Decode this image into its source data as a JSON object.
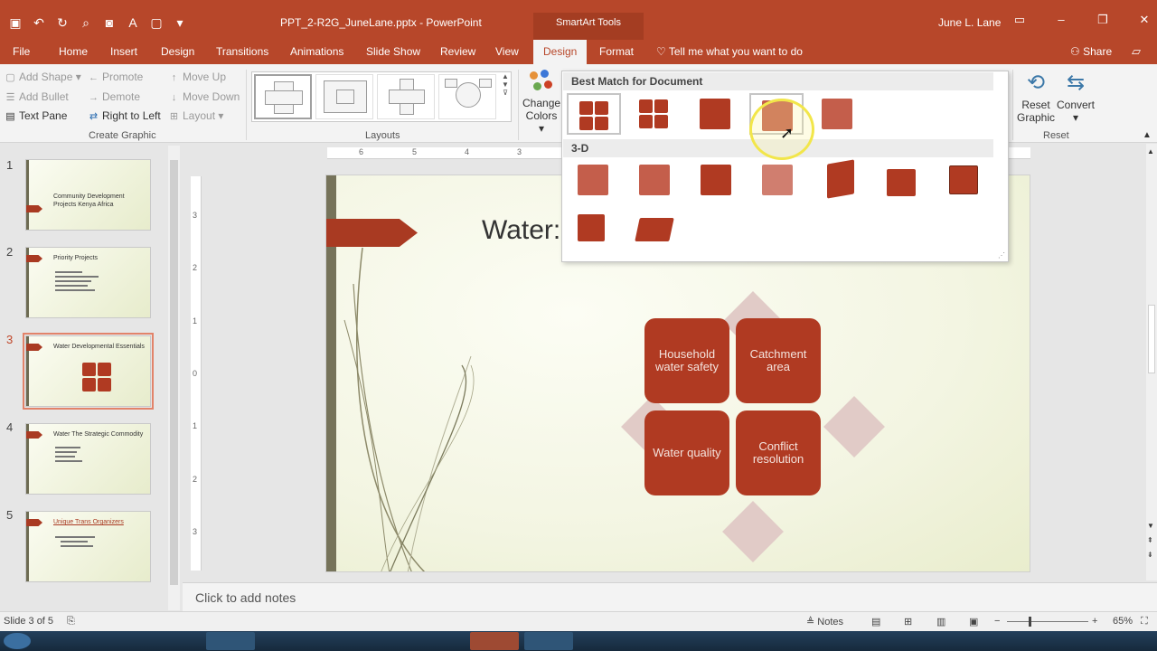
{
  "titlebar": {
    "document_title": "PPT_2-R2G_JuneLane.pptx  -  PowerPoint",
    "context_tools": "SmartArt Tools",
    "user": "June L. Lane",
    "qat_icons": [
      "save-icon",
      "undo-icon",
      "redo-icon",
      "preview-icon",
      "screenshot-icon",
      "font-color-icon",
      "new-icon",
      "customize-icon"
    ]
  },
  "tabs": [
    {
      "label": "File"
    },
    {
      "label": "Home"
    },
    {
      "label": "Insert"
    },
    {
      "label": "Design"
    },
    {
      "label": "Transitions"
    },
    {
      "label": "Animations"
    },
    {
      "label": "Slide Show"
    },
    {
      "label": "Review"
    },
    {
      "label": "View"
    },
    {
      "label": "Design",
      "active": true
    },
    {
      "label": "Format"
    }
  ],
  "tell_me": "Tell me what you want to do",
  "share": "Share",
  "ribbon": {
    "create_graphic": {
      "label": "Create Graphic",
      "add_shape": "Add Shape",
      "add_bullet": "Add Bullet",
      "text_pane": "Text Pane",
      "promote": "Promote",
      "demote": "Demote",
      "right_to_left": "Right to Left",
      "move_up": "Move Up",
      "move_down": "Move Down",
      "layout": "Layout"
    },
    "layouts": {
      "label": "Layouts"
    },
    "change_colors": [
      "Change",
      "Colors"
    ],
    "reset": {
      "label": "Reset",
      "reset_graphic": [
        "Reset",
        "Graphic"
      ],
      "convert": "Convert"
    }
  },
  "styles_panel": {
    "best_match_header": "Best Match for Document",
    "three_d_header": "3-D"
  },
  "slides": [
    {
      "num": "1",
      "title": "Community Development Projects Kenya Africa"
    },
    {
      "num": "2",
      "title": "Priority Projects"
    },
    {
      "num": "3",
      "title": "Water Developmental Essentials"
    },
    {
      "num": "4",
      "title": "Water The Strategic Commodity"
    },
    {
      "num": "5",
      "title": "Unique Trans Organizers"
    }
  ],
  "ruler": {
    "horizontal": [
      "6",
      "5",
      "4",
      "3"
    ],
    "vertical": [
      "3",
      "2",
      "1",
      "0",
      "1",
      "2",
      "3"
    ]
  },
  "slide": {
    "title_partial": "Water:",
    "boxes": [
      "Household water safety",
      "Catchment area",
      "Water quality",
      "Conflict resolution"
    ],
    "accent_color": "#b03a22"
  },
  "notes_placeholder": "Click to add notes",
  "status": {
    "slide_indicator": "Slide 3 of 5",
    "notes_button": "Notes",
    "zoom": "65%"
  }
}
